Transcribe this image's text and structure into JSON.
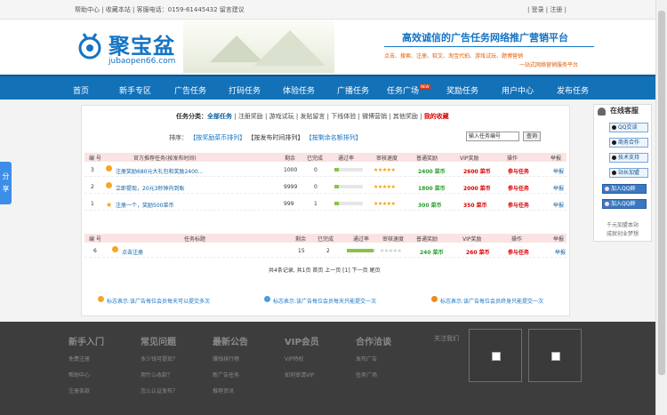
{
  "topbar": {
    "left": "帮助中心 | 收藏本站 | 客服电话：0159-61445432   留言建议",
    "right": "| 登录 | 注册 |"
  },
  "header": {
    "logo_name": "聚宝盆",
    "logo_domain": "jubaopen66.com",
    "slogan": "高效诚信的广告任务网络推广营销平台",
    "sub1": "点击、搜索、注册、软文、淘宝代拍、游戏试玩、题博营销",
    "sub2": "一站式网络营销服务平台"
  },
  "nav": [
    "首页",
    "新手专区",
    "广告任务",
    "打码任务",
    "体验任务",
    "广播任务",
    "任务广场",
    "奖励任务",
    "用户中心",
    "发布任务"
  ],
  "nav_hot": "NEW",
  "filter": {
    "label": "任务分类：",
    "all": "全部任务",
    "items": [
      "注册奖励",
      "游戏试玩",
      "发贴留言",
      "下线体验",
      "微博营销",
      "其他奖励"
    ],
    "fav": "我的收藏"
  },
  "sort": {
    "label": "排序：",
    "opt1": "【按奖励菜币排列】",
    "opt2": "【按发布时间排列】",
    "opt3": "【按剩余名额排列】",
    "search_value": "输入任务编号",
    "search_btn": "查询"
  },
  "table1": {
    "headers": [
      "编 号",
      "官方推荐任务(按发布时间)",
      "剩余",
      "已完成",
      "通过率",
      "审核速度",
      "普通奖励",
      "VIP奖励",
      "操作",
      "举报"
    ],
    "rows": [
      {
        "id": "3",
        "title": "注册奖励680元大礼包和奖励2400...",
        "left": "1000",
        "done": "0",
        "rate": 0.15,
        "stars": "★★★★★",
        "normal": "2400 菜币",
        "vip": "2600 菜币",
        "op": "参与任务",
        "report": "举报"
      },
      {
        "id": "2",
        "title": "立即提现，20元3秒钟内到账",
        "left": "9999",
        "done": "0",
        "rate": 0.15,
        "stars": "★★★★★",
        "normal": "1800 菜币",
        "vip": "2000 菜币",
        "op": "参与任务",
        "report": "举报"
      },
      {
        "id": "1",
        "title": "注册一个，奖励500菜币",
        "left": "999",
        "done": "1",
        "rate": 0.15,
        "stars": "★★★★★",
        "normal": "300 菜币",
        "vip": "350 菜币",
        "op": "参与任务",
        "report": "举报"
      }
    ]
  },
  "table2": {
    "headers": [
      "编 号",
      "任务标题",
      "剩余",
      "已完成",
      "通过率",
      "审核速度",
      "普通奖励",
      "VIP奖励",
      "操作",
      "举报"
    ],
    "rows": [
      {
        "id": "6",
        "title": "点击注册",
        "left": "15",
        "done": "2",
        "rate": 0.95,
        "stars": "★★★★★",
        "normal": "240 菜币",
        "vip": "260 菜币",
        "op": "参与任务",
        "report": "举报"
      }
    ]
  },
  "pager": "共4条记录, 共1页 首页 上一页 [1] 下一页 尾页",
  "notes": [
    "标志表示:该广告每位会员每天可以提交多次",
    "标志表示:该广告每位会员每天只能提交一次",
    "标志表示:该广告每位会员终身只能提交一次"
  ],
  "share": "分享",
  "cs": {
    "title": "在线客服",
    "btns": [
      "QQ交谈",
      "商务合作",
      "技术支持",
      "站长加盟"
    ],
    "groups": [
      "加入QQ群",
      "加入QQ群"
    ],
    "foot1": "千元加盟本站",
    "foot2": "成就创业梦想"
  },
  "footer": {
    "cols": [
      {
        "h": "新手入门",
        "l": [
          "免费注册",
          "帮助中心",
          "注册条款"
        ]
      },
      {
        "h": "常见问题",
        "l": [
          "多少钱可提现？",
          "用什么收款？",
          "怎么认证发布？"
        ]
      },
      {
        "h": "最新公告",
        "l": [
          "赚钱排行榜",
          "新广告任务",
          "推荐资讯"
        ]
      },
      {
        "h": "VIP会员",
        "l": [
          "VIP特权",
          "如何审请VIP"
        ]
      },
      {
        "h": "合作洽谈",
        "l": [
          "发布广告",
          "任务广场"
        ]
      }
    ],
    "follow": "关注我们"
  },
  "colors": {
    "nav": "#1371b8",
    "brand": "#1574c4",
    "accent_red": "#dd0000",
    "footer": "#3d3d3d"
  }
}
